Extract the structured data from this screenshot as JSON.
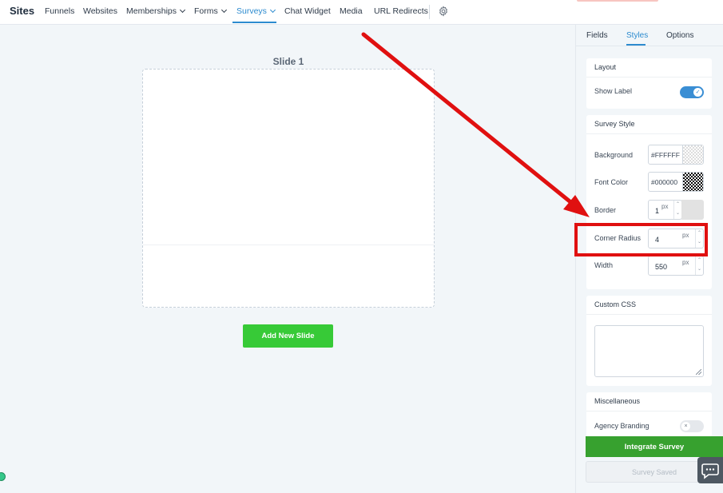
{
  "nav": {
    "brand": "Sites",
    "items": [
      {
        "label": "Funnels"
      },
      {
        "label": "Websites"
      },
      {
        "label": "Memberships"
      },
      {
        "label": "Forms"
      },
      {
        "label": "Surveys"
      },
      {
        "label": "Chat Widget"
      },
      {
        "label": "Media"
      },
      {
        "label": "URL Redirects"
      }
    ],
    "settings_icon": "gear-icon"
  },
  "canvas": {
    "slide_title": "Slide 1",
    "add_slide_label": "Add New Slide"
  },
  "panel": {
    "tabs": [
      {
        "label": "Fields"
      },
      {
        "label": "Styles"
      },
      {
        "label": "Options"
      }
    ],
    "active_tab": "Styles",
    "layout": {
      "title": "Layout",
      "show_label": "Show Label",
      "show_label_on": true
    },
    "survey_style": {
      "title": "Survey Style",
      "background_label": "Background",
      "background_value": "#FFFFFF",
      "font_color_label": "Font Color",
      "font_color_value": "#000000",
      "border_label": "Border",
      "border_value": "1",
      "corner_radius_label": "Corner Radius",
      "corner_radius_value": "4",
      "width_label": "Width",
      "width_value": "550",
      "unit": "px"
    },
    "custom_css": {
      "title": "Custom CSS",
      "value": ""
    },
    "misc": {
      "title": "Miscellaneous",
      "agency_branding": "Agency Branding",
      "agency_branding_on": false
    },
    "integrate_label": "Integrate Survey",
    "saved_label": "Survey Saved"
  },
  "colors": {
    "accent": "#2d8bcf",
    "green": "#37ca37",
    "integrate_green": "#37a12f",
    "annotation_red": "#e01010"
  }
}
